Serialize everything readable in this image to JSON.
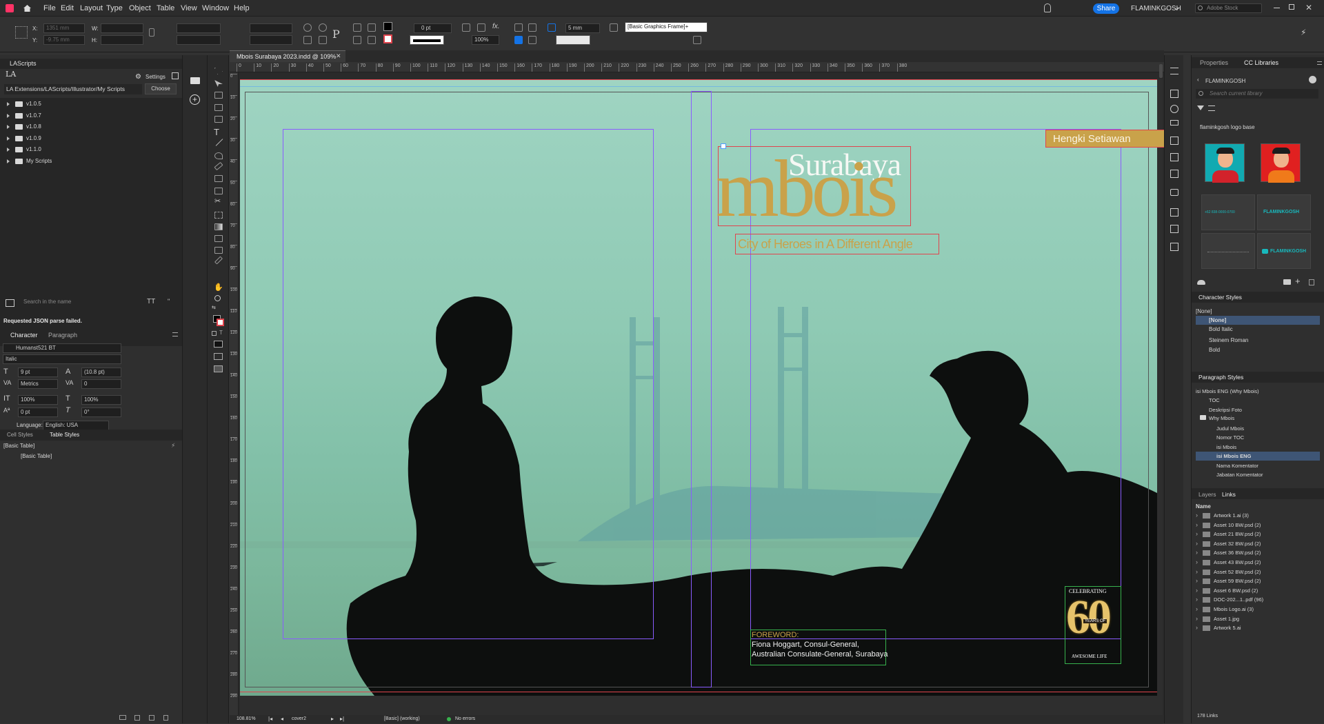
{
  "menu": {
    "items": [
      "File",
      "Edit",
      "Layout",
      "Type",
      "Object",
      "Table",
      "View",
      "Window",
      "Help"
    ],
    "share": "Share",
    "user": "FLAMINKGOSH",
    "stock_placeholder": "Adobe Stock"
  },
  "control": {
    "x_label": "X:",
    "y_label": "Y:",
    "w_label": "W:",
    "h_label": "H:",
    "x_val": "1351 mm",
    "y_val": "-9.75 mm",
    "stroke": "0 pt",
    "scale": "100%",
    "mm": "5 mm",
    "frame_style": "[Basic Graphics Frame]+"
  },
  "left": {
    "panel_title": "LAScripts",
    "settings": "Settings",
    "path": "LA Extensions/LAScripts/Illustrator/My Scripts",
    "choose": "Choose",
    "folders": [
      "v1.0.5",
      "v1.0.7",
      "v1.0.8",
      "v1.0.9",
      "v1.1.0",
      "My Scripts"
    ],
    "search_placeholder": "Search in the name",
    "error": "Requested JSON parse failed.",
    "tabs": [
      "Character",
      "Paragraph"
    ],
    "font": "Humanst521 BT",
    "style": "Italic",
    "size": "9 pt",
    "leading": "(10.8 pt)",
    "kerning": "Metrics",
    "tracking": "0",
    "vscale": "100%",
    "hscale": "100%",
    "baseline": "0 pt",
    "skew": "0°",
    "lang_label": "Language:",
    "lang": "English: USA",
    "styles_tabs": [
      "Cell Styles",
      "Table Styles"
    ],
    "table_style_current": "[Basic Table]",
    "table_style_item": "[Basic Table]"
  },
  "doc": {
    "tab": "Mbois Surabaya 2023.indd @ 109%",
    "ruler": [
      "0",
      "10",
      "20",
      "30",
      "40",
      "50",
      "60",
      "70",
      "80",
      "90",
      "100",
      "110",
      "120",
      "130",
      "140",
      "150",
      "160",
      "170",
      "180",
      "190",
      "200",
      "210",
      "220",
      "230",
      "240",
      "250",
      "260",
      "270",
      "280",
      "290",
      "300",
      "310",
      "320",
      "330",
      "340",
      "350",
      "360",
      "370",
      "380"
    ],
    "vruler": [
      "0",
      "10",
      "20",
      "30",
      "40",
      "50",
      "60",
      "70",
      "80",
      "90",
      "100",
      "110",
      "120",
      "130",
      "140",
      "150",
      "160",
      "170",
      "180",
      "190",
      "200",
      "210",
      "220",
      "230",
      "240",
      "250",
      "260",
      "270",
      "280",
      "290"
    ],
    "author": "Hengki Setiawan",
    "city": "Surabaya",
    "title": "mbois",
    "subtitle": "City of Heroes in A Different Angle",
    "foreword": "FOREWORD:",
    "foreword_l1": "Fiona Hoggart, Consul-General,",
    "foreword_l2": "Australian Consulate-General, Surabaya",
    "badge_top": "CELEBRATING",
    "badge_num": "60",
    "badge_mid": "YEARS OF",
    "badge_bot": "AWESOME LIFE"
  },
  "status": {
    "zoom": "108.81%",
    "page": "cover2",
    "style": "[Basic] (working)",
    "errors": "No errors"
  },
  "right": {
    "tabs": [
      "Properties",
      "CC Libraries"
    ],
    "library": "FLAMINKGOSH",
    "lib_search": "Search current library",
    "group": "flaminkgosh logo base",
    "tile_text": "FLAMINKGOSH",
    "tile_phone": "+62 838-0000-0700",
    "char_styles_title": "Character Styles",
    "char_current": "[None]",
    "char_styles": [
      "[None]",
      "Bold Italic",
      "Steinem Roman",
      "Bold"
    ],
    "para_styles_title": "Paragraph Styles",
    "para_current": "isi Mbois ENG (Why Mbois)",
    "para_styles": [
      "TOC",
      "Deskripsi Foto",
      "Why Mbois",
      "Judul Mbois",
      "Nomor TOC",
      "isi Mbois",
      "isi Mbois ENG",
      "Nama Komentator",
      "Jabatan Komentator"
    ],
    "links_tabs": [
      "Layers",
      "Links"
    ],
    "links_header": "Name",
    "links": [
      {
        "name": "Artwork 1.ai (3)"
      },
      {
        "name": "Asset 10 BW.psd (2)"
      },
      {
        "name": "Asset 21 BW.psd (2)"
      },
      {
        "name": "Asset 32 BW.psd (2)"
      },
      {
        "name": "Asset 36 BW.psd (2)"
      },
      {
        "name": "Asset 43 BW.psd (2)"
      },
      {
        "name": "Asset 52 BW.psd (2)"
      },
      {
        "name": "Asset 59 BW.psd (2)"
      },
      {
        "name": "Asset 6 BW.psd (2)"
      },
      {
        "name": "DOC-202...1..pdf (96)"
      },
      {
        "name": "Mbois Logo.ai (3)"
      },
      {
        "name": "Asset 1.jpg"
      },
      {
        "name": "Artwork 5.ai"
      }
    ],
    "link_count": "178 Links"
  },
  "colors": {
    "gold": "#c9a24a",
    "teal_bg": "#8ec9b2",
    "accent": "#1473e6"
  }
}
